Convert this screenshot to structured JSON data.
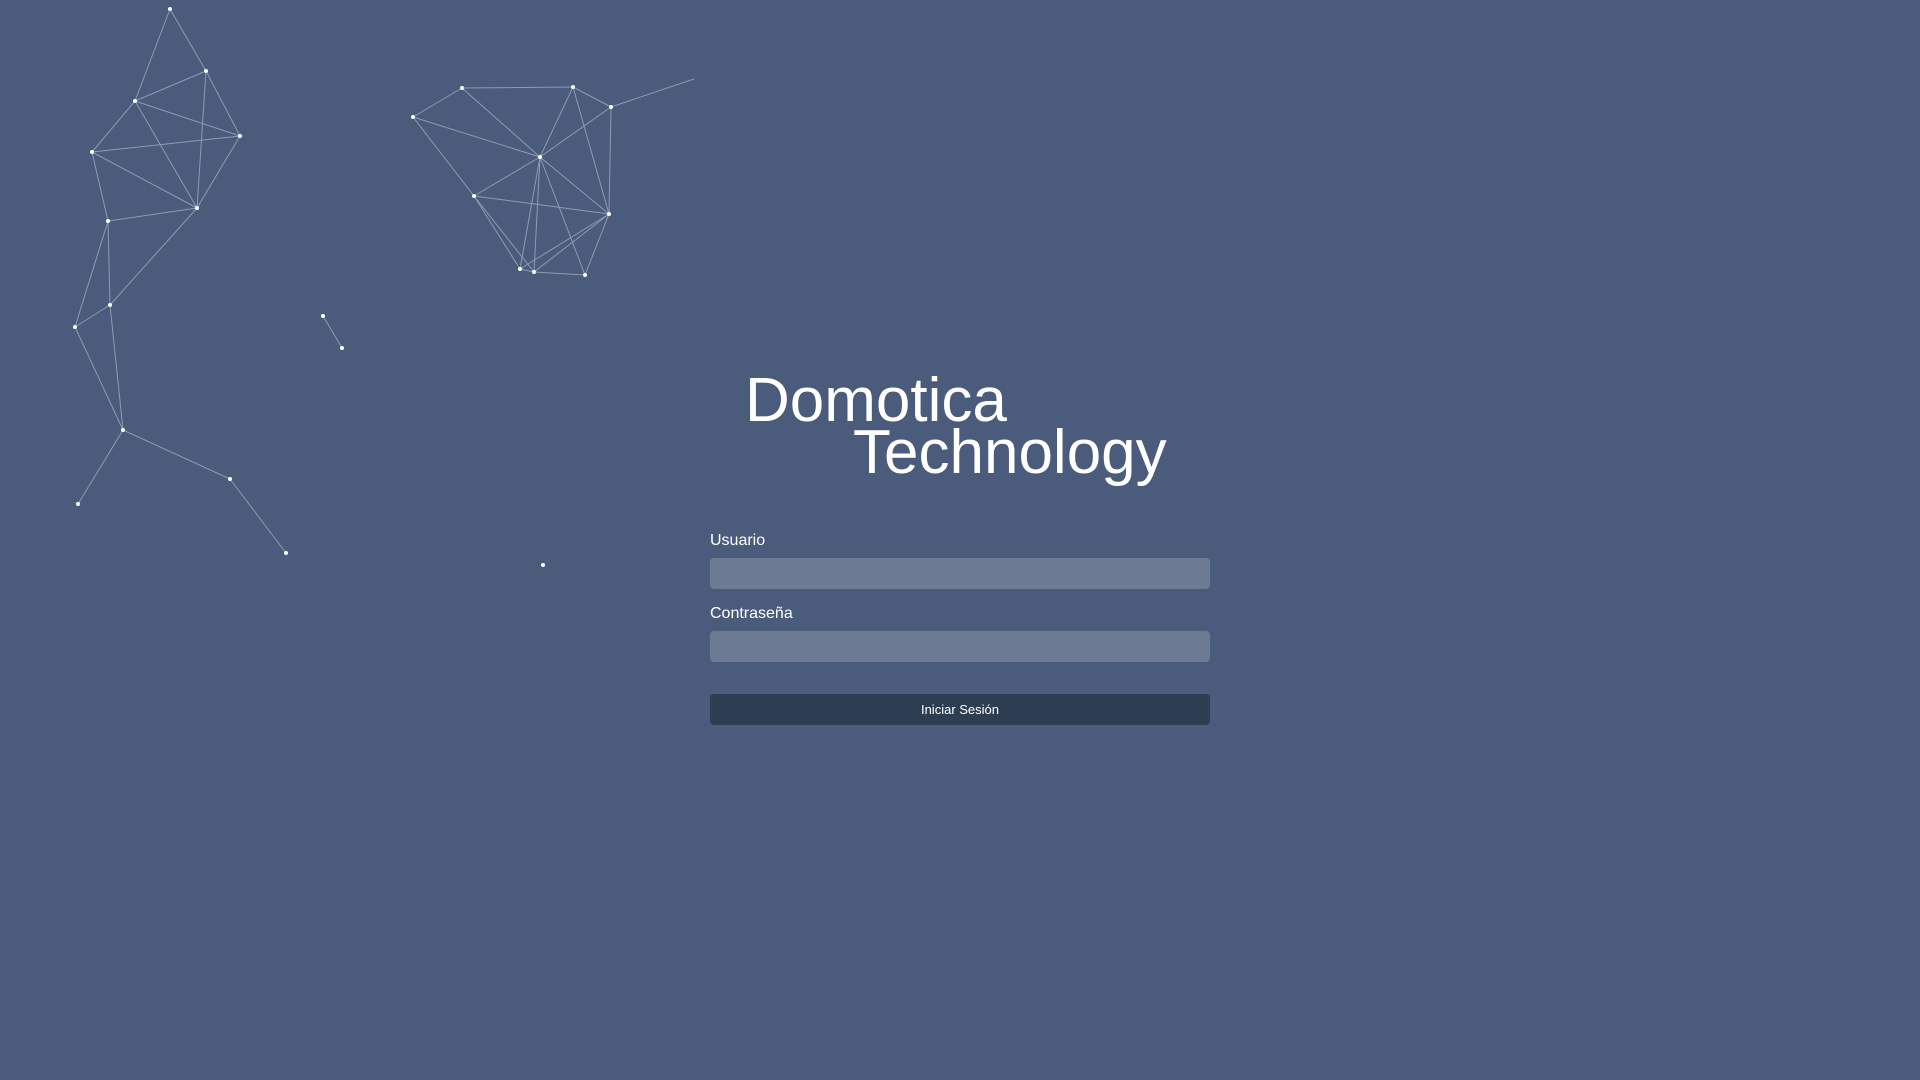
{
  "brand": {
    "line1": "Domotica",
    "line2": "Technology"
  },
  "login": {
    "username_label": "Usuario",
    "username_value": "",
    "password_label": "Contraseña",
    "password_value": "",
    "submit_label": "Iniciar Sesión"
  },
  "colors": {
    "background": "#4b5b7b",
    "input_background": "#6c7a94",
    "button_background": "#2d3e52",
    "text": "#ffffff",
    "network_line": "#9aa6bd",
    "network_node": "#ffffff"
  }
}
